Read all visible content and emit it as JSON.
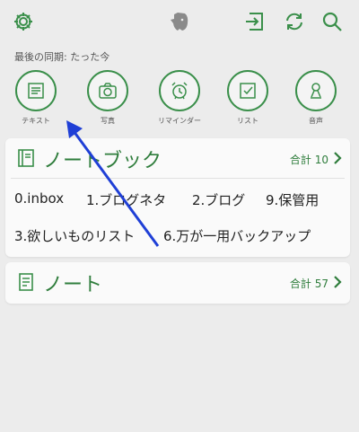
{
  "topbar": {
    "settings_icon": "gear-icon",
    "logo_icon": "evernote-elephant-icon",
    "share_icon": "share-arrow-icon",
    "sync_icon": "sync-icon",
    "search_icon": "search-icon"
  },
  "sync_status": "最後の同期: たった今",
  "quick_actions": [
    {
      "label": "テキスト",
      "icon": "text-note-icon"
    },
    {
      "label": "写真",
      "icon": "camera-icon"
    },
    {
      "label": "リマインダー",
      "icon": "alarm-clock-icon"
    },
    {
      "label": "リスト",
      "icon": "checkbox-icon"
    },
    {
      "label": "音声",
      "icon": "microphone-icon"
    }
  ],
  "notebooks": {
    "title": "ノートブック",
    "count": "合計 10",
    "items": [
      "0.inbox",
      "1.ブログネタ",
      "2.ブログ",
      "9.保管用",
      "3.欲しいものリスト",
      "6.万が一用バックアップ"
    ]
  },
  "notes": {
    "title": "ノート",
    "count": "合計 57"
  },
  "colors": {
    "accent": "#2f7d3c",
    "annotation_arrow": "#1f3fd6",
    "background": "#ececec"
  }
}
